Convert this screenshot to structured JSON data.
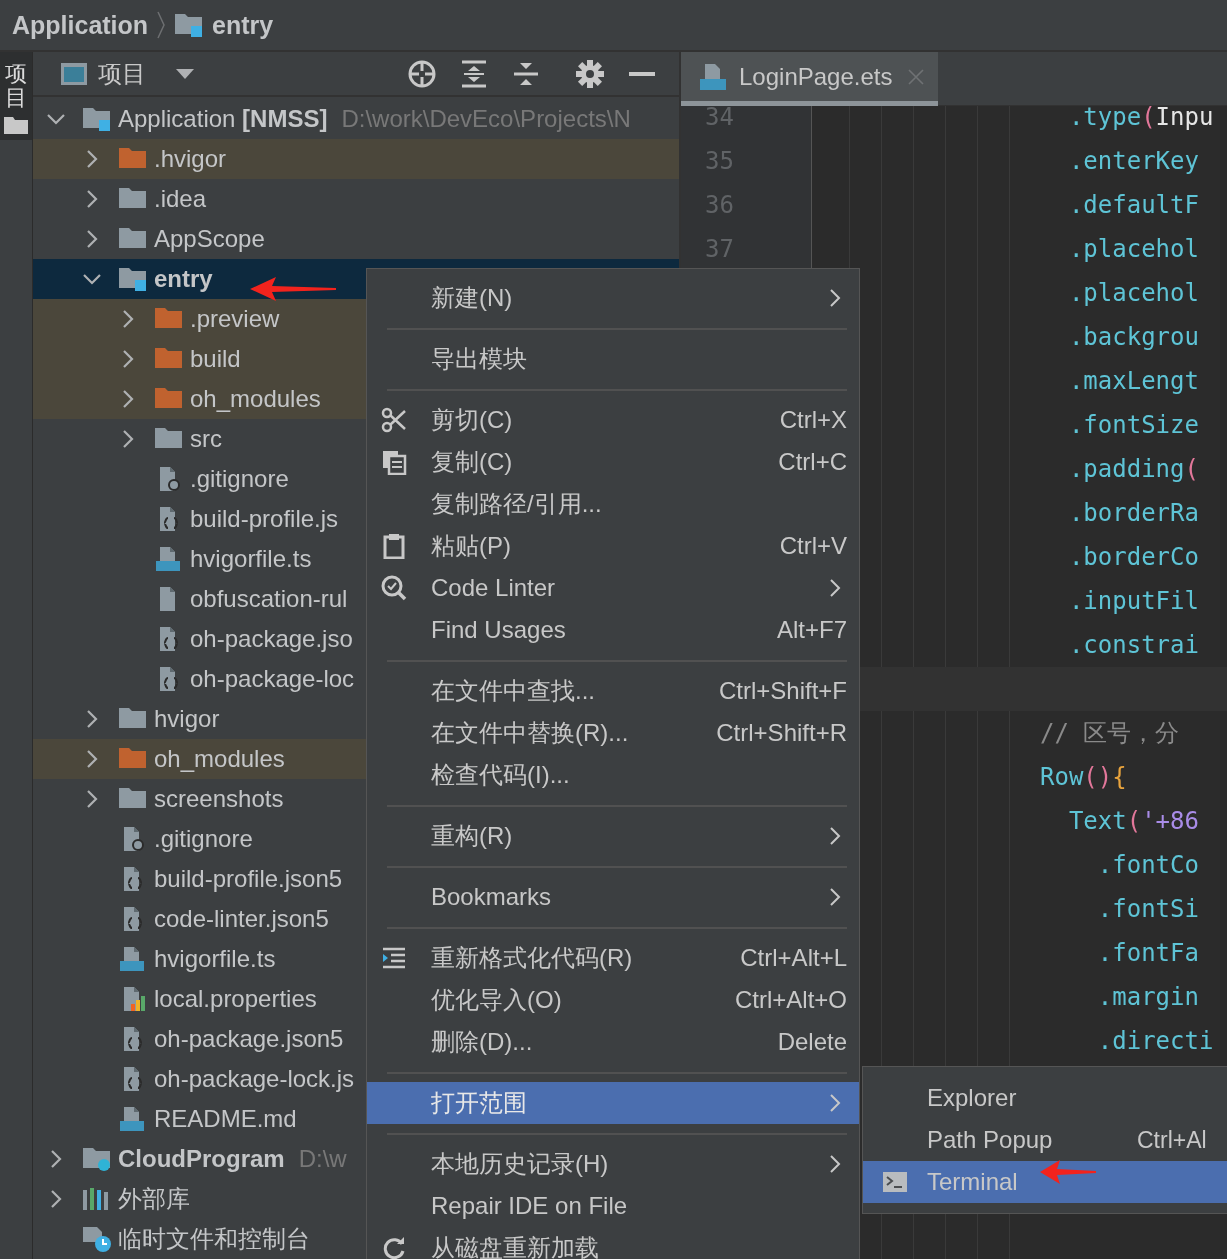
{
  "breadcrumb": [
    {
      "label": "Application",
      "kind": "plain"
    },
    {
      "label": "entry",
      "kind": "module"
    }
  ],
  "tool_strip": {
    "tabs": [
      {
        "label": "项目",
        "selected": true
      }
    ]
  },
  "project_panel": {
    "title": "项目",
    "tree": [
      {
        "label": "Application **[NMSS]**",
        "suffix": "D:\\work\\DevEco\\Projects\\N",
        "kind": "project",
        "expanded": true,
        "selected": false,
        "children": [
          {
            "label": ".hvigor",
            "kind": "folder",
            "expanded": false,
            "excluded": true,
            "selected": false
          },
          {
            "label": ".idea",
            "kind": "folder",
            "expanded": false,
            "excluded": false,
            "selected": false
          },
          {
            "label": "AppScope",
            "kind": "folder",
            "expanded": false,
            "excluded": false,
            "selected": false
          },
          {
            "label": "entry",
            "kind": "module",
            "expanded": true,
            "selected": true,
            "children": [
              {
                "label": ".preview",
                "kind": "folder",
                "expanded": false,
                "excluded": true,
                "selected": false
              },
              {
                "label": "build",
                "kind": "folder",
                "expanded": false,
                "excluded": true,
                "selected": false
              },
              {
                "label": "oh_modules",
                "kind": "folder",
                "expanded": false,
                "excluded": true,
                "selected": false
              },
              {
                "label": "src",
                "kind": "folder",
                "expanded": false,
                "excluded": false,
                "selected": false
              },
              {
                "label": ".gitignore",
                "kind": "gitignore",
                "selected": false
              },
              {
                "label": "build-profile.js",
                "kind": "json",
                "selected": false
              },
              {
                "label": "hvigorfile.ts",
                "kind": "ts",
                "selected": false
              },
              {
                "label": "obfuscation-rul",
                "kind": "file",
                "selected": false
              },
              {
                "label": "oh-package.jso",
                "kind": "json",
                "selected": false
              },
              {
                "label": "oh-package-loc",
                "kind": "json",
                "selected": false
              }
            ]
          },
          {
            "label": "hvigor",
            "kind": "folder",
            "expanded": false,
            "excluded": false,
            "selected": false
          },
          {
            "label": "oh_modules",
            "kind": "folder",
            "expanded": false,
            "excluded": true,
            "selected": false
          },
          {
            "label": "screenshots",
            "kind": "folder",
            "expanded": false,
            "excluded": false,
            "selected": false
          },
          {
            "label": ".gitignore",
            "kind": "gitignore",
            "selected": false
          },
          {
            "label": "build-profile.json5",
            "kind": "json",
            "selected": false
          },
          {
            "label": "code-linter.json5",
            "kind": "json",
            "selected": false
          },
          {
            "label": "hvigorfile.ts",
            "kind": "ts",
            "selected": false
          },
          {
            "label": "local.properties",
            "kind": "properties",
            "selected": false
          },
          {
            "label": "oh-package.json5",
            "kind": "json",
            "selected": false
          },
          {
            "label": "oh-package-lock.js",
            "kind": "json",
            "selected": false
          },
          {
            "label": "README.md",
            "kind": "md",
            "selected": false
          }
        ]
      },
      {
        "label": "CloudProgram",
        "suffix": "D:\\w",
        "kind": "cloud",
        "expanded": false,
        "selected": false
      },
      {
        "label": "外部库",
        "kind": "library",
        "expanded": false,
        "selected": false
      },
      {
        "label": "临时文件和控制台",
        "kind": "scratch",
        "selected": false
      }
    ]
  },
  "editor": {
    "tabs": [
      {
        "label": "LoginPage.ets",
        "selected": true
      }
    ],
    "line_numbers": [
      "34",
      "35",
      "36",
      "37"
    ],
    "code_lines": [
      {
        "current": false,
        "tokens": [
          {
            "kind": "fn",
            "t": "  .type"
          },
          {
            "kind": "paren",
            "t": "("
          },
          {
            "kind": "plain",
            "t": "Inpu"
          }
        ]
      },
      {
        "current": false,
        "tokens": [
          {
            "kind": "fn",
            "t": "  .enterKey"
          }
        ]
      },
      {
        "current": false,
        "tokens": [
          {
            "kind": "fn",
            "t": "  .defaultF"
          }
        ]
      },
      {
        "current": false,
        "tokens": [
          {
            "kind": "fn",
            "t": "  .placehol"
          }
        ]
      },
      {
        "current": false,
        "tokens": [
          {
            "kind": "fn",
            "t": "  .placehol"
          }
        ]
      },
      {
        "current": false,
        "tokens": [
          {
            "kind": "fn",
            "t": "  .backgrou"
          }
        ]
      },
      {
        "current": false,
        "tokens": [
          {
            "kind": "fn",
            "t": "  .maxLengt"
          }
        ]
      },
      {
        "current": false,
        "tokens": [
          {
            "kind": "fn",
            "t": "  .fontSize"
          }
        ]
      },
      {
        "current": false,
        "tokens": [
          {
            "kind": "fn",
            "t": "  .padding"
          },
          {
            "kind": "paren",
            "t": "("
          }
        ]
      },
      {
        "current": false,
        "tokens": [
          {
            "kind": "fn",
            "t": "  .borderRa"
          }
        ]
      },
      {
        "current": false,
        "tokens": [
          {
            "kind": "fn",
            "t": "  .borderCo"
          }
        ]
      },
      {
        "current": false,
        "tokens": [
          {
            "kind": "fn",
            "t": "  .inputFil"
          }
        ]
      },
      {
        "current": false,
        "tokens": [
          {
            "kind": "fn",
            "t": "  .constrai"
          }
        ]
      },
      {
        "current": true
      },
      {
        "current": false,
        "tokens": [
          {
            "kind": "comment",
            "t": "// 区号，分"
          }
        ]
      },
      {
        "current": false,
        "tokens": [
          {
            "kind": "fn",
            "t": "Row"
          },
          {
            "kind": "paren",
            "t": "()"
          },
          {
            "kind": "brace",
            "t": "{"
          }
        ]
      },
      {
        "current": false,
        "tokens": [
          {
            "kind": "fn",
            "t": "  Text"
          },
          {
            "kind": "paren",
            "t": "("
          },
          {
            "kind": "str",
            "t": "'+86"
          }
        ]
      },
      {
        "current": false,
        "tokens": [
          {
            "kind": "fn",
            "t": "    .fontCo"
          }
        ]
      },
      {
        "current": false,
        "tokens": [
          {
            "kind": "fn",
            "t": "    .fontSi"
          }
        ]
      },
      {
        "current": false,
        "tokens": [
          {
            "kind": "fn",
            "t": "    .fontFa"
          }
        ]
      },
      {
        "current": false,
        "tokens": [
          {
            "kind": "fn",
            "t": "    .margin"
          }
        ]
      },
      {
        "current": false,
        "tokens": [
          {
            "kind": "fn",
            "t": "    .directi"
          }
        ]
      }
    ]
  },
  "context_menu": {
    "items": [
      {
        "kind": "item",
        "label": "新建(N)",
        "submenu": true,
        "selected": false
      },
      {
        "kind": "separator"
      },
      {
        "kind": "item",
        "label": "导出模块",
        "selected": false
      },
      {
        "kind": "separator"
      },
      {
        "kind": "item",
        "label": "剪切(C)",
        "shortcut": "Ctrl+X",
        "selected": false
      },
      {
        "kind": "item",
        "label": "复制(C)",
        "shortcut": "Ctrl+C",
        "selected": false
      },
      {
        "kind": "item",
        "label": "复制路径/引用...",
        "selected": false
      },
      {
        "kind": "item",
        "label": "粘贴(P)",
        "shortcut": "Ctrl+V",
        "selected": false
      },
      {
        "kind": "item",
        "label": "Code Linter",
        "submenu": true,
        "selected": false
      },
      {
        "kind": "item",
        "label": "Find Usages",
        "shortcut": "Alt+F7",
        "selected": false
      },
      {
        "kind": "separator"
      },
      {
        "kind": "item",
        "label": "在文件中查找...",
        "shortcut": "Ctrl+Shift+F",
        "selected": false
      },
      {
        "kind": "item",
        "label": "在文件中替换(R)...",
        "shortcut": "Ctrl+Shift+R",
        "selected": false
      },
      {
        "kind": "item",
        "label": "检查代码(I)...",
        "selected": false
      },
      {
        "kind": "separator"
      },
      {
        "kind": "item",
        "label": "重构(R)",
        "submenu": true,
        "selected": false
      },
      {
        "kind": "separator"
      },
      {
        "kind": "item",
        "label": "Bookmarks",
        "submenu": true,
        "selected": false
      },
      {
        "kind": "separator"
      },
      {
        "kind": "item",
        "label": "重新格式化代码(R)",
        "shortcut": "Ctrl+Alt+L",
        "selected": false
      },
      {
        "kind": "item",
        "label": "优化导入(O)",
        "shortcut": "Ctrl+Alt+O",
        "selected": false
      },
      {
        "kind": "item",
        "label": "删除(D)...",
        "shortcut": "Delete",
        "selected": false
      },
      {
        "kind": "separator"
      },
      {
        "kind": "item",
        "label": "打开范围",
        "submenu": true,
        "selected": true
      },
      {
        "kind": "separator"
      },
      {
        "kind": "item",
        "label": "本地历史记录(H)",
        "submenu": true,
        "selected": false
      },
      {
        "kind": "item",
        "label": "Repair IDE on File",
        "selected": false
      },
      {
        "kind": "item",
        "label": "从磁盘重新加载",
        "selected": false
      }
    ]
  },
  "submenu": {
    "items": [
      {
        "label": "Explorer",
        "selected": false
      },
      {
        "label": "Path Popup",
        "shortcut": "Ctrl+Al",
        "selected": false
      },
      {
        "label": "Terminal",
        "selected": true
      }
    ]
  }
}
